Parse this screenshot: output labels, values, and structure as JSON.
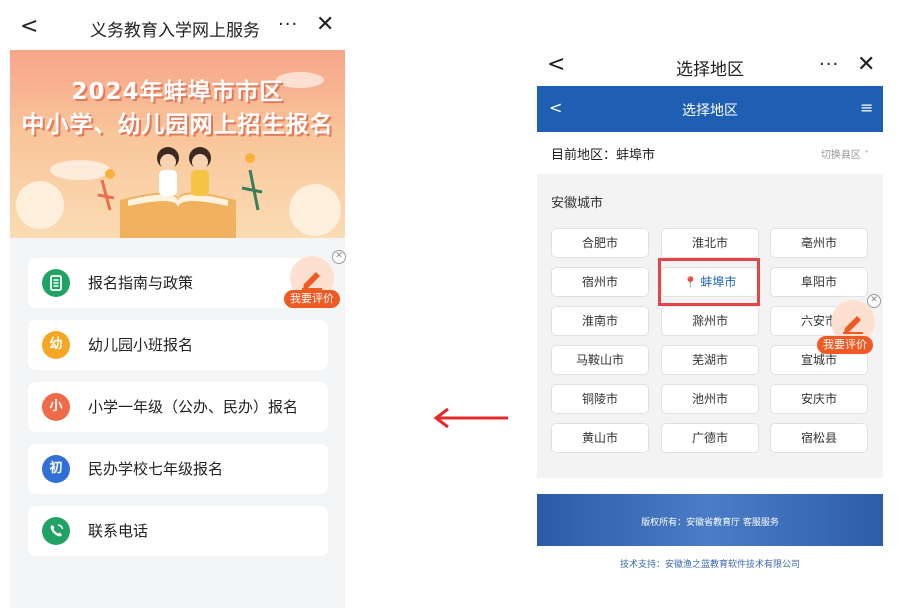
{
  "left": {
    "topbar": {
      "back": "<",
      "title": "义务教育入学网上服务",
      "more": "···",
      "close": "✕"
    },
    "banner": {
      "line1": "2024年蚌埠市市区",
      "line2": "中小学、幼儿园网上招生报名"
    },
    "menu": [
      {
        "label": "报名指南与政策",
        "icon": "document-icon",
        "icon_text": "",
        "color": "#21a366"
      },
      {
        "label": "幼儿园小班报名",
        "icon": "kindergarten-badge-icon",
        "icon_text": "幼",
        "color": "#f5a623"
      },
      {
        "label": "小学一年级（公办、民办）报名",
        "icon": "primary-badge-icon",
        "icon_text": "小",
        "color": "#f06a4a"
      },
      {
        "label": "民办学校七年级报名",
        "icon": "junior-badge-icon",
        "icon_text": "初",
        "color": "#2f6fd6"
      },
      {
        "label": "联系电话",
        "icon": "phone-icon",
        "icon_text": "",
        "color": "#21a366"
      }
    ],
    "eval_button": "我要评价"
  },
  "right": {
    "topbar": {
      "back": "<",
      "title": "选择地区",
      "more": "···",
      "close": "✕"
    },
    "bluebar": {
      "back": "<",
      "title": "选择地区",
      "menu": "≡"
    },
    "current_label": "目前地区：蚌埠市",
    "switch_label": "切换县区 ˅",
    "section_title": "安徽城市",
    "cities": [
      [
        "合肥市",
        "淮北市",
        "亳州市"
      ],
      [
        "宿州市",
        "蚌埠市",
        "阜阳市"
      ],
      [
        "淮南市",
        "滁州市",
        "六安市"
      ],
      [
        "马鞍山市",
        "芜湖市",
        "宣城市"
      ],
      [
        "铜陵市",
        "池州市",
        "安庆市"
      ],
      [
        "黄山市",
        "广德市",
        "宿松县"
      ]
    ],
    "selected_city": "蚌埠市",
    "eval_button": "我要评价",
    "footer_copyright": "版权所有：安徽省教育厅 客服服务",
    "tech_support": "技术支持：安徽渔之蓝教育软件技术有限公司"
  },
  "colors": {
    "accent_blue": "#1f5fb3",
    "highlight_red": "#e0464c",
    "eval_orange": "#ef5a24",
    "arrow_red": "#e32b2b"
  }
}
